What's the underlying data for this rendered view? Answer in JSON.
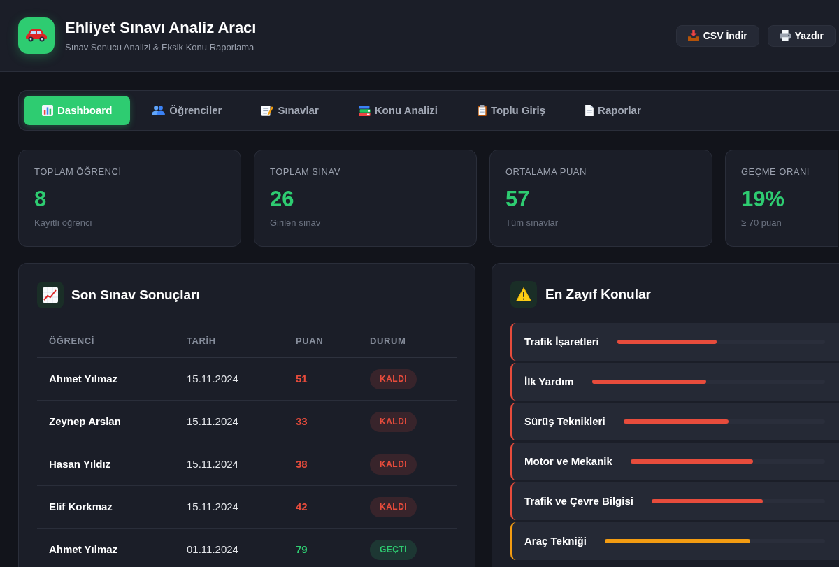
{
  "header": {
    "title": "Ehliyet Sınavı Analiz Aracı",
    "subtitle": "Sınav Sonucu Analizi & Eksik Konu Raporlama",
    "actions": [
      "CSV İndir",
      "Yazdır"
    ]
  },
  "tabs": [
    {
      "label": "Dashboard",
      "selected": true
    },
    {
      "label": "Öğrenciler",
      "selected": false
    },
    {
      "label": "Sınavlar",
      "selected": false
    },
    {
      "label": "Konu Analizi",
      "selected": false
    },
    {
      "label": "Toplu Giriş",
      "selected": false
    },
    {
      "label": "Raporlar",
      "selected": false
    }
  ],
  "stats": [
    {
      "label": "TOPLAM ÖĞRENCİ",
      "value": "8",
      "caption": "Kayıtlı öğrenci"
    },
    {
      "label": "TOPLAM SINAV",
      "value": "26",
      "caption": "Girilen sınav"
    },
    {
      "label": "ORTALAMA PUAN",
      "value": "57",
      "caption": "Tüm sınavlar"
    },
    {
      "label": "GEÇME ORANI",
      "value": "19%",
      "caption": "≥ 70 puan"
    }
  ],
  "recent_results": {
    "title": "Son Sınav Sonuçları",
    "columns": [
      "ÖĞRENCİ",
      "TARİH",
      "PUAN",
      "DURUM"
    ],
    "rows": [
      {
        "student": "Ahmet Yılmaz",
        "date": "15.11.2024",
        "score": "51",
        "status": "KALDI",
        "passed": false
      },
      {
        "student": "Zeynep Arslan",
        "date": "15.11.2024",
        "score": "33",
        "status": "KALDI",
        "passed": false
      },
      {
        "student": "Hasan Yıldız",
        "date": "15.11.2024",
        "score": "38",
        "status": "KALDI",
        "passed": false
      },
      {
        "student": "Elif Korkmaz",
        "date": "15.11.2024",
        "score": "42",
        "status": "KALDI",
        "passed": false
      },
      {
        "student": "Ahmet Yılmaz",
        "date": "01.11.2024",
        "score": "79",
        "status": "GEÇTİ",
        "passed": true
      }
    ]
  },
  "weak_topics": {
    "title": "En Zayıf Konular",
    "items": [
      {
        "name": "Trafik İşaretleri",
        "level": 0.48,
        "color": "#e74c3c"
      },
      {
        "name": "İlk Yardım",
        "level": 0.49,
        "color": "#e74c3c"
      },
      {
        "name": "Sürüş Teknikleri",
        "level": 0.52,
        "color": "#e74c3c"
      },
      {
        "name": "Motor ve Mekanik",
        "level": 0.63,
        "color": "#e74c3c"
      },
      {
        "name": "Trafik ve Çevre Bilgisi",
        "level": 0.64,
        "color": "#e74c3c"
      },
      {
        "name": "Araç Tekniği",
        "level": 0.66,
        "color": "#f39c12"
      }
    ]
  }
}
